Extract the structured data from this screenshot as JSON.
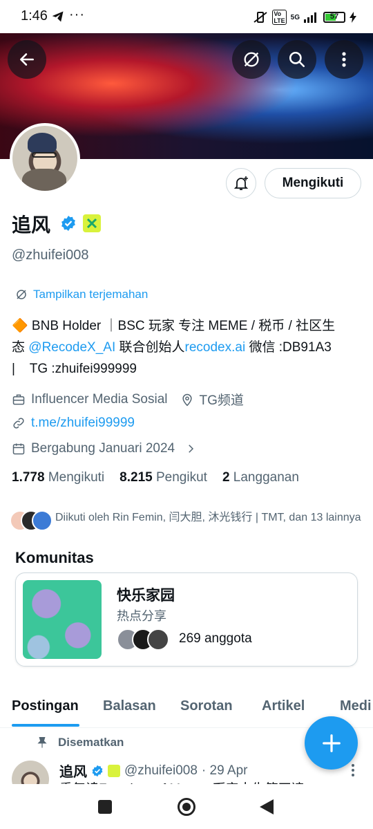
{
  "status_bar": {
    "time": "1:46",
    "network": "5G",
    "battery": "57",
    "battery_level": 0.57
  },
  "header": {
    "back_icon": "arrow-left-icon",
    "translate_off_icon": "no-translate-icon",
    "search_icon": "search-icon",
    "more_icon": "more-vertical-icon"
  },
  "profile": {
    "name": "追风",
    "handle": "@zhuifei008",
    "follow_button": "Mengikuti",
    "translate_label": "Tampilkan terjemahan",
    "bio": {
      "line1": "🔶 BNB Holder ｜BSC 玩家 专注 MEME / 税币 / 社区生",
      "line2_pre": "态 ",
      "mention": "@RecodeX_AI",
      "line2_mid": " 联合创始人",
      "site": "recodex.ai",
      "line2_post": " 微信 :DB91A3",
      "line3": "|    TG :zhuifei999999"
    },
    "category": "Influencer Media Sosial",
    "location": "TG频道",
    "link": "t.me/zhuifei99999",
    "joined": "Bergabung Januari 2024",
    "stats": {
      "following_count": "1.778",
      "following_label": "Mengikuti",
      "followers_count": "8.215",
      "followers_label": "Pengikut",
      "subs_count": "2",
      "subs_label": "Langganan"
    },
    "followed_by": "Diikuti oleh Rin Femin, 闫大胆, 沐光钱行 | TMT, dan 13 lainnya"
  },
  "community": {
    "section_title": "Komunitas",
    "name": "快乐家园",
    "subtitle": "热点分享",
    "members": "269 anggota"
  },
  "tabs": [
    "Postingan",
    "Balasan",
    "Sorotan",
    "Artikel",
    "Medi"
  ],
  "pinned_post": {
    "pinned_label": "Disematkan",
    "name": "追风",
    "handle": "@zhuifei008",
    "date": "· 29 Apr",
    "text": "重复读Freedom of Money 币安人生第四遍"
  },
  "colors": {
    "accent": "#1d9bf0",
    "text": "#0f1419",
    "muted": "#536471",
    "badge": "#d9f23c"
  }
}
